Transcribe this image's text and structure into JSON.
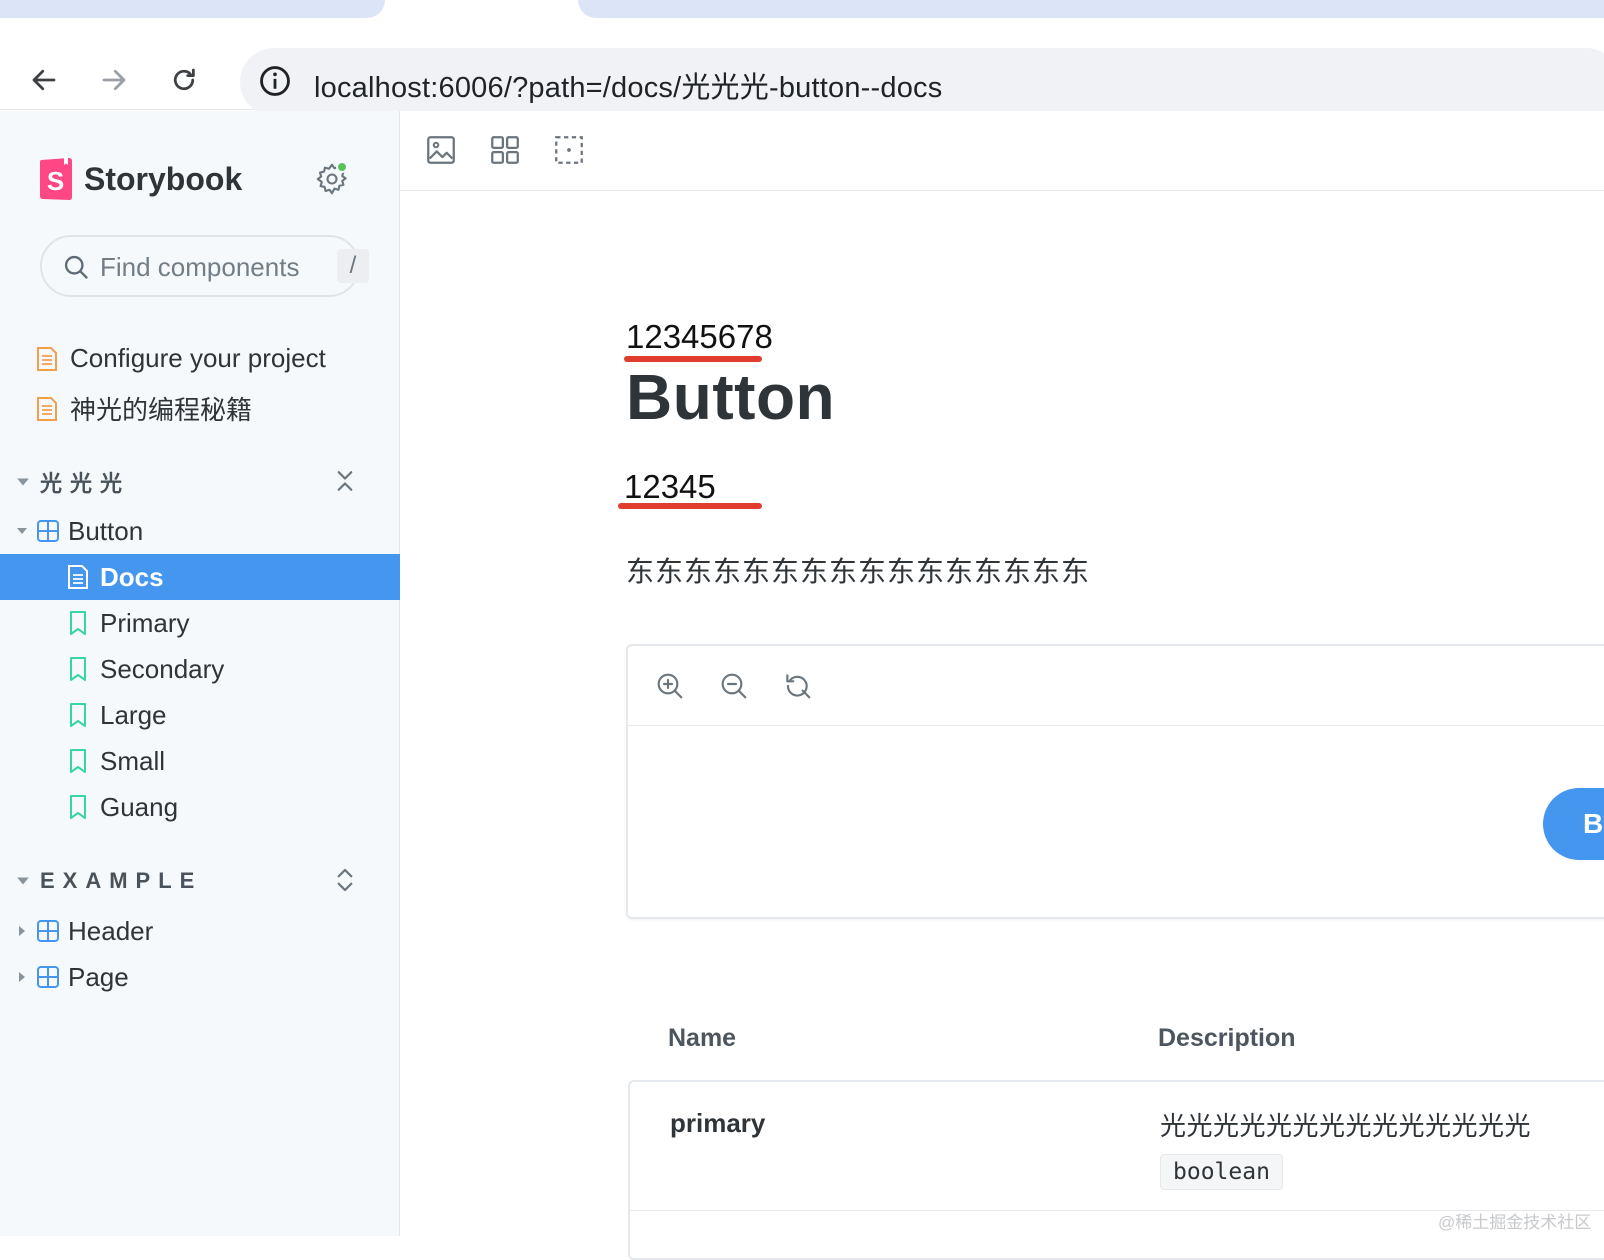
{
  "browser": {
    "url": "localhost:6006/?path=/docs/光光光-button--docs"
  },
  "sidebar": {
    "brand": "Storybook",
    "search": {
      "placeholder": "Find components",
      "shortcut": "/"
    },
    "docs": [
      {
        "label": "Configure your project"
      },
      {
        "label": "神光的编程秘籍"
      }
    ],
    "groups": [
      {
        "label": "光光光",
        "items": [
          {
            "label": "Button"
          },
          {
            "label": "Docs"
          },
          {
            "label": "Primary"
          },
          {
            "label": "Secondary"
          },
          {
            "label": "Large"
          },
          {
            "label": "Small"
          },
          {
            "label": "Guang"
          }
        ]
      },
      {
        "label": "EXAMPLE",
        "items": [
          {
            "label": "Header"
          },
          {
            "label": "Page"
          }
        ]
      }
    ]
  },
  "main": {
    "annotation_top": "12345678",
    "title": "Button",
    "annotation_bottom": "12345",
    "description": "东东东东东东东东东东东东东东东东",
    "preview_button": "Button",
    "args": {
      "headers": {
        "name": "Name",
        "description": "Description"
      },
      "rows": [
        {
          "name": "primary",
          "description": "光光光光光光光光光光光光光光",
          "type": "boolean"
        }
      ]
    }
  },
  "watermark": "@稀土掘金技术社区",
  "colors": {
    "accent": "#4496ef",
    "brand_pink": "#ff4785",
    "annotation_red": "#e03d2e",
    "status_green": "#5bc25a"
  }
}
